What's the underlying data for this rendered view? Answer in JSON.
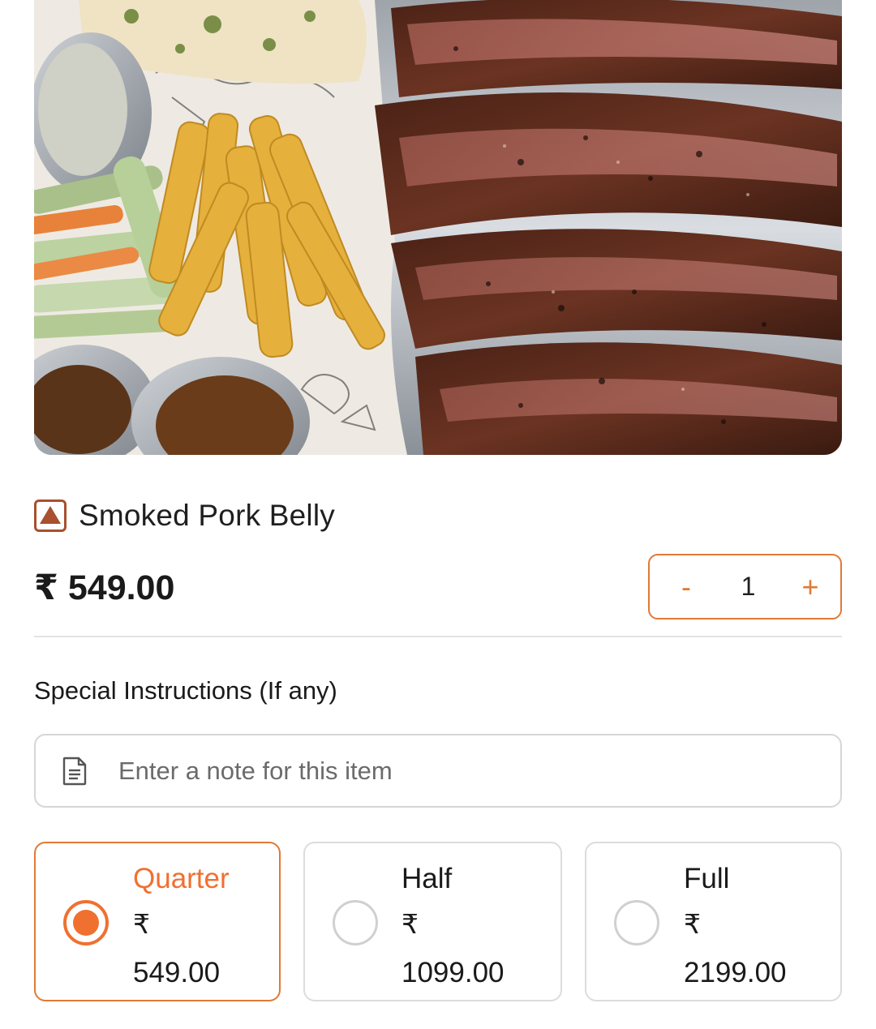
{
  "item": {
    "title": "Smoked Pork Belly",
    "diet_mark": "non-veg-icon",
    "price": "₹ 549.00"
  },
  "quantity": {
    "decrement_label": "-",
    "value": "1",
    "increment_label": "+"
  },
  "instructions": {
    "label": "Special Instructions (If any)",
    "placeholder": "Enter a note for this item",
    "value": "",
    "icon": "note-icon"
  },
  "options": [
    {
      "name": "Quarter",
      "currency": "₹",
      "price": "549.00",
      "selected": true
    },
    {
      "name": "Half",
      "currency": "₹",
      "price": "1099.00",
      "selected": false
    },
    {
      "name": "Full",
      "currency": "₹",
      "price": "2199.00",
      "selected": false
    }
  ],
  "colors": {
    "accent": "#f07030",
    "stepper_border": "#e07a36",
    "nonveg_mark": "#a8502f"
  }
}
